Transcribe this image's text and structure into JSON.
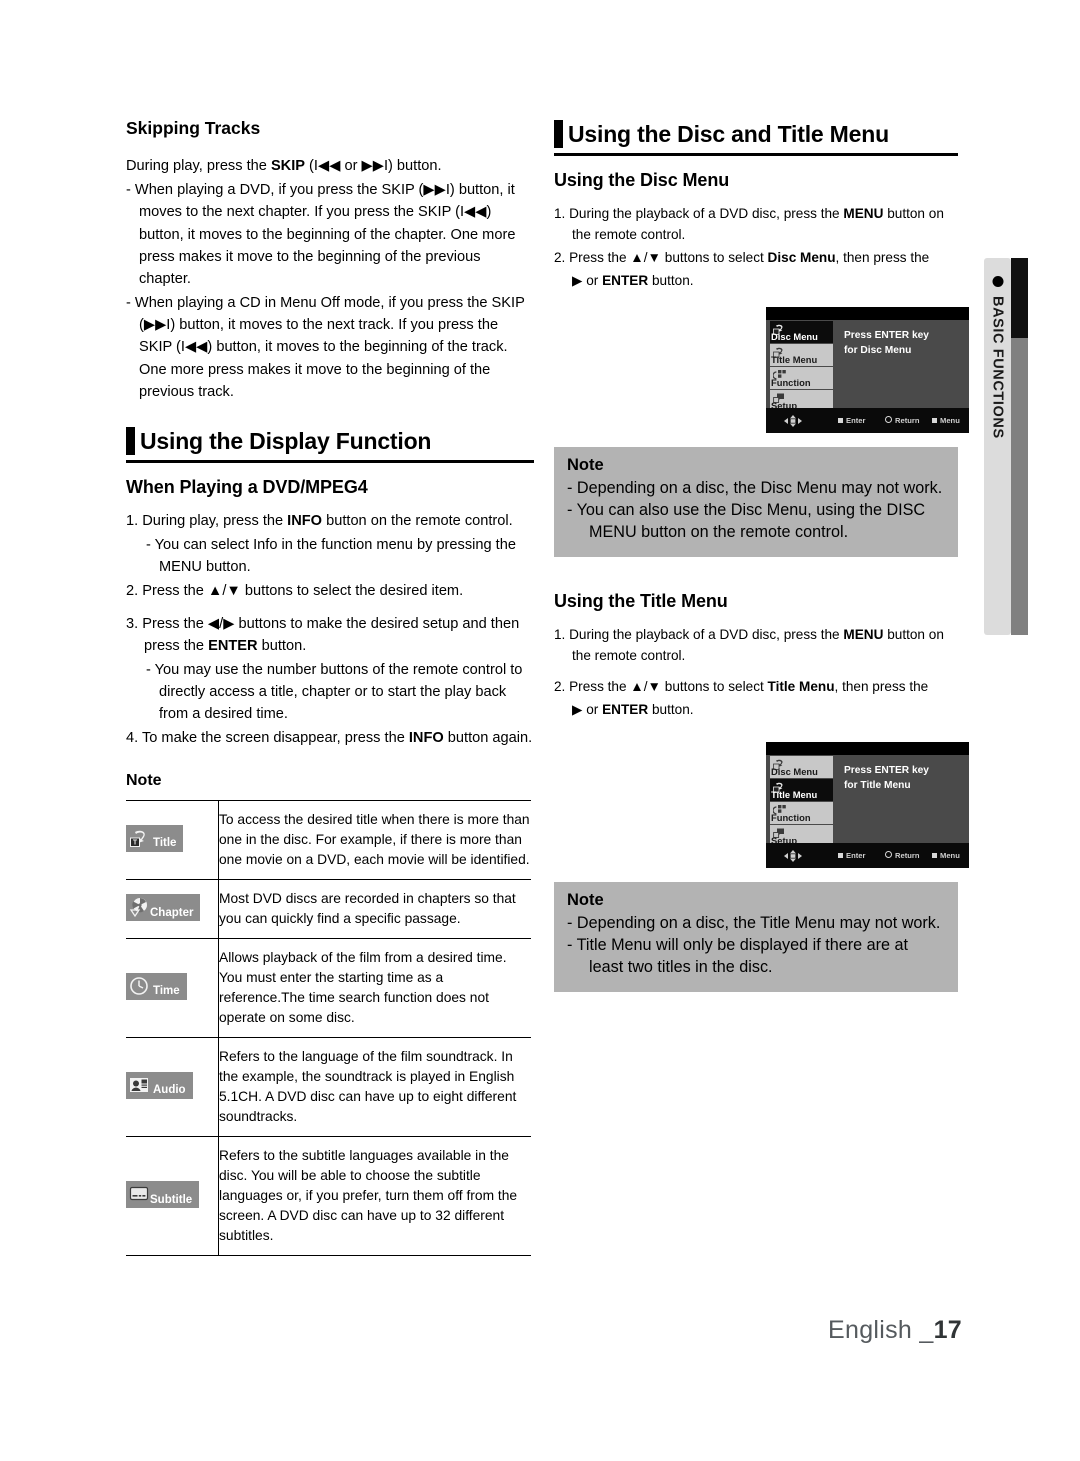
{
  "document": {
    "footer_lang": "English _",
    "footer_page": "17",
    "side_tab_label": "BASIC FUNCTIONS"
  },
  "left_column": {
    "skipping": {
      "heading": "Skipping Tracks",
      "intro_pre": "During play, press the ",
      "intro_bold": "SKIP",
      "intro_post": " (I◀◀ or ▶▶I) button.",
      "bullets": [
        "- When playing a DVD, if you press the SKIP (▶▶I) button, it moves to the next chapter. If you press the SKIP (I◀◀) button, it moves to the beginning of the chapter. One more press makes it move to the beginning of the previous chapter.",
        "- When playing a CD in Menu Off mode, if you press the SKIP (▶▶I) button, it moves to the next track. If you press the SKIP (I◀◀) button, it moves to the beginning of the track. One more press makes it move to the beginning of the previous track."
      ]
    },
    "display_function": {
      "heading": "Using the Display Function",
      "subheading": "When Playing a DVD/MPEG4",
      "steps": [
        {
          "num": "1.",
          "text_pre": "During play, press the ",
          "bold": "INFO",
          "text_post": " button on the remote control."
        },
        {
          "num": "",
          "text_pre": "- You can select Info in the function menu by pressing the MENU button.",
          "bold": "",
          "text_post": ""
        },
        {
          "num": "2.",
          "text_pre": "Press the ▲/▼ buttons to select the desired item.",
          "bold": "",
          "text_post": ""
        },
        {
          "num": "3.",
          "text_pre": "Press the ◀/▶ buttons to make the desired setup and then press the ",
          "bold": "ENTER",
          "text_post": " button."
        },
        {
          "num": "",
          "text_pre": "- You may use the number buttons of the remote control to directly access a title, chapter or to start the play back from a desired time.",
          "bold": "",
          "text_post": ""
        },
        {
          "num": "4.",
          "text_pre": "To make the screen disappear, press the ",
          "bold": "INFO",
          "text_post": " button again."
        }
      ],
      "note_label": "Note",
      "table_rows": [
        {
          "icon_name": "title-icon",
          "badge_label": "Title",
          "description": "To access the desired title when there is more than one in the disc. For example, if there is more than one movie on a DVD, each movie will be identified."
        },
        {
          "icon_name": "chapter-icon",
          "badge_label": "Chapter",
          "description": "Most DVD discs are recorded in chapters so that you can quickly find a specific passage."
        },
        {
          "icon_name": "time-icon",
          "badge_label": "Time",
          "description": "Allows playback of the film from a desired time. You must enter the starting time as a reference.The time search function does not operate on some disc."
        },
        {
          "icon_name": "audio-icon",
          "badge_label": "Audio",
          "description": "Refers to the language of the film soundtrack. In the example, the soundtrack is played in English 5.1CH. A DVD disc can have up to eight different soundtracks."
        },
        {
          "icon_name": "subtitle-icon",
          "badge_label": "Subtitle",
          "description": "Refers to the subtitle languages available in the disc. You will be able to choose the subtitle languages or, if you prefer, turn them off from the screen. A DVD disc can have up to 32 different subtitles."
        }
      ]
    }
  },
  "right_column": {
    "heading": "Using the Disc and Title Menu",
    "disc_menu": {
      "subheading": "Using the Disc Menu",
      "step1_pre": "1. During the playback of a DVD disc, press the ",
      "step1_bold": "MENU",
      "step1_post": " button on the remote control.",
      "step2_pre": "2. Press the ▲/▼ buttons to select ",
      "step2_bold": "Disc Menu",
      "step2_mid": ", then press the ",
      "step2_line2_pre": "▶ or ",
      "step2_line2_bold": "ENTER",
      "step2_line2_post": " button."
    },
    "disc_tv": {
      "menu_items": [
        "Disc Menu",
        "Title Menu",
        "Function",
        "Setup"
      ],
      "active_index": 0,
      "message_line1": "Press ENTER key",
      "message_line2": "for Disc Menu",
      "hints": [
        "Enter",
        "Return",
        "Menu"
      ]
    },
    "disc_note": {
      "title": "Note",
      "lines": [
        "-  Depending on a disc, the Disc Menu may not work.",
        "-  You can also use the Disc Menu, using the DISC MENU button on the remote control."
      ]
    },
    "title_menu": {
      "subheading": "Using the Title Menu",
      "step1_pre": "1. During the playback of a DVD disc, press the ",
      "step1_bold": "MENU",
      "step1_post": " button on the remote control.",
      "step2_pre": "2. Press the ▲/▼ buttons to select ",
      "step2_bold": "Title Menu",
      "step2_mid": ", then press the ",
      "step2_line2_pre": "▶ or ",
      "step2_line2_bold": "ENTER",
      "step2_line2_post": " button."
    },
    "title_tv": {
      "menu_items": [
        "Disc Menu",
        "Title Menu",
        "Function",
        "Setup"
      ],
      "active_index": 1,
      "message_line1": "Press ENTER key",
      "message_line2": "for Title Menu",
      "hints": [
        "Enter",
        "Return",
        "Menu"
      ]
    },
    "title_note": {
      "title": "Note",
      "lines": [
        "-  Depending on a disc, the Title Menu may not work.",
        "-  Title Menu will only be displayed if there are at least two titles in the disc."
      ]
    }
  }
}
